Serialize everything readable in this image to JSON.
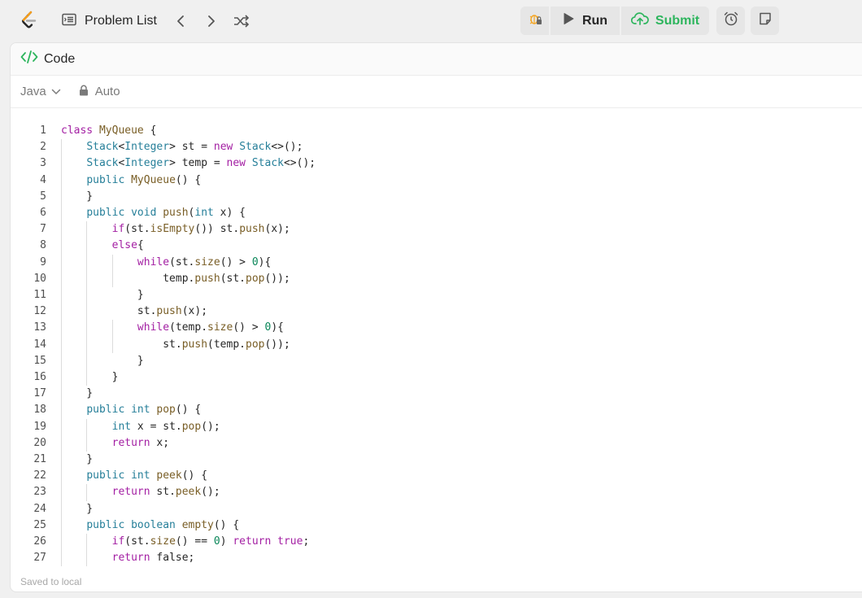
{
  "topbar": {
    "problem_list_label": "Problem List",
    "run_label": "Run",
    "submit_label": "Submit"
  },
  "panel": {
    "title": "Code",
    "language": "Java",
    "mode": "Auto",
    "status": "Saved to local"
  },
  "colors": {
    "submit_green": "#2db55d",
    "debug_orange": "#f5a623",
    "keyword": "#a31fa3",
    "type": "#267f99",
    "function": "#795e26",
    "number": "#098658"
  },
  "editor": {
    "lines": [
      [
        {
          "t": "class ",
          "c": "kw"
        },
        {
          "t": "MyQueue",
          "c": "fn"
        },
        {
          "t": " {",
          "c": ""
        }
      ],
      [
        {
          "t": "    ",
          "c": ""
        },
        {
          "t": "Stack",
          "c": "ty"
        },
        {
          "t": "<",
          "c": ""
        },
        {
          "t": "Integer",
          "c": "ty"
        },
        {
          "t": "> st = ",
          "c": ""
        },
        {
          "t": "new ",
          "c": "kw"
        },
        {
          "t": "Stack",
          "c": "ty"
        },
        {
          "t": "<>();",
          "c": ""
        }
      ],
      [
        {
          "t": "    ",
          "c": ""
        },
        {
          "t": "Stack",
          "c": "ty"
        },
        {
          "t": "<",
          "c": ""
        },
        {
          "t": "Integer",
          "c": "ty"
        },
        {
          "t": "> temp = ",
          "c": ""
        },
        {
          "t": "new ",
          "c": "kw"
        },
        {
          "t": "Stack",
          "c": "ty"
        },
        {
          "t": "<>();",
          "c": ""
        }
      ],
      [
        {
          "t": "    ",
          "c": ""
        },
        {
          "t": "public ",
          "c": "ty"
        },
        {
          "t": "MyQueue",
          "c": "fn"
        },
        {
          "t": "() {",
          "c": ""
        }
      ],
      [
        {
          "t": "    }",
          "c": ""
        }
      ],
      [
        {
          "t": "    ",
          "c": ""
        },
        {
          "t": "public void ",
          "c": "ty"
        },
        {
          "t": "push",
          "c": "fn"
        },
        {
          "t": "(",
          "c": ""
        },
        {
          "t": "int",
          "c": "ty"
        },
        {
          "t": " x) {",
          "c": ""
        }
      ],
      [
        {
          "t": "        ",
          "c": ""
        },
        {
          "t": "if",
          "c": "kw"
        },
        {
          "t": "(st.",
          "c": ""
        },
        {
          "t": "isEmpty",
          "c": "fn"
        },
        {
          "t": "()) st.",
          "c": ""
        },
        {
          "t": "push",
          "c": "fn"
        },
        {
          "t": "(x);",
          "c": ""
        }
      ],
      [
        {
          "t": "        ",
          "c": ""
        },
        {
          "t": "else",
          "c": "kw"
        },
        {
          "t": "{",
          "c": ""
        }
      ],
      [
        {
          "t": "            ",
          "c": ""
        },
        {
          "t": "while",
          "c": "kw"
        },
        {
          "t": "(st.",
          "c": ""
        },
        {
          "t": "size",
          "c": "fn"
        },
        {
          "t": "() > ",
          "c": ""
        },
        {
          "t": "0",
          "c": "num"
        },
        {
          "t": "){",
          "c": ""
        }
      ],
      [
        {
          "t": "                temp.",
          "c": ""
        },
        {
          "t": "push",
          "c": "fn"
        },
        {
          "t": "(st.",
          "c": ""
        },
        {
          "t": "pop",
          "c": "fn"
        },
        {
          "t": "());",
          "c": ""
        }
      ],
      [
        {
          "t": "            }",
          "c": ""
        }
      ],
      [
        {
          "t": "            st.",
          "c": ""
        },
        {
          "t": "push",
          "c": "fn"
        },
        {
          "t": "(x);",
          "c": ""
        }
      ],
      [
        {
          "t": "            ",
          "c": ""
        },
        {
          "t": "while",
          "c": "kw"
        },
        {
          "t": "(temp.",
          "c": ""
        },
        {
          "t": "size",
          "c": "fn"
        },
        {
          "t": "() > ",
          "c": ""
        },
        {
          "t": "0",
          "c": "num"
        },
        {
          "t": "){",
          "c": ""
        }
      ],
      [
        {
          "t": "                st.",
          "c": ""
        },
        {
          "t": "push",
          "c": "fn"
        },
        {
          "t": "(temp.",
          "c": ""
        },
        {
          "t": "pop",
          "c": "fn"
        },
        {
          "t": "());",
          "c": ""
        }
      ],
      [
        {
          "t": "            }",
          "c": ""
        }
      ],
      [
        {
          "t": "        }",
          "c": ""
        }
      ],
      [
        {
          "t": "    }",
          "c": ""
        }
      ],
      [
        {
          "t": "    ",
          "c": ""
        },
        {
          "t": "public int ",
          "c": "ty"
        },
        {
          "t": "pop",
          "c": "fn"
        },
        {
          "t": "() {",
          "c": ""
        }
      ],
      [
        {
          "t": "        ",
          "c": ""
        },
        {
          "t": "int",
          "c": "ty"
        },
        {
          "t": " x = st.",
          "c": ""
        },
        {
          "t": "pop",
          "c": "fn"
        },
        {
          "t": "();",
          "c": ""
        }
      ],
      [
        {
          "t": "        ",
          "c": ""
        },
        {
          "t": "return",
          "c": "kw"
        },
        {
          "t": " x;",
          "c": ""
        }
      ],
      [
        {
          "t": "    }",
          "c": ""
        }
      ],
      [
        {
          "t": "    ",
          "c": ""
        },
        {
          "t": "public int ",
          "c": "ty"
        },
        {
          "t": "peek",
          "c": "fn"
        },
        {
          "t": "() {",
          "c": ""
        }
      ],
      [
        {
          "t": "        ",
          "c": ""
        },
        {
          "t": "return",
          "c": "kw"
        },
        {
          "t": " st.",
          "c": ""
        },
        {
          "t": "peek",
          "c": "fn"
        },
        {
          "t": "();",
          "c": ""
        }
      ],
      [
        {
          "t": "    }",
          "c": ""
        }
      ],
      [
        {
          "t": "    ",
          "c": ""
        },
        {
          "t": "public boolean ",
          "c": "ty"
        },
        {
          "t": "empty",
          "c": "fn"
        },
        {
          "t": "() {",
          "c": ""
        }
      ],
      [
        {
          "t": "        ",
          "c": ""
        },
        {
          "t": "if",
          "c": "kw"
        },
        {
          "t": "(st.",
          "c": ""
        },
        {
          "t": "size",
          "c": "fn"
        },
        {
          "t": "() == ",
          "c": ""
        },
        {
          "t": "0",
          "c": "num"
        },
        {
          "t": ") ",
          "c": ""
        },
        {
          "t": "return",
          "c": "kw"
        },
        {
          "t": " ",
          "c": ""
        },
        {
          "t": "true",
          "c": "kw"
        },
        {
          "t": ";",
          "c": ""
        }
      ],
      [
        {
          "t": "        ",
          "c": ""
        },
        {
          "t": "return",
          "c": "kw"
        },
        {
          "t": " false;",
          "c": ""
        }
      ]
    ]
  }
}
